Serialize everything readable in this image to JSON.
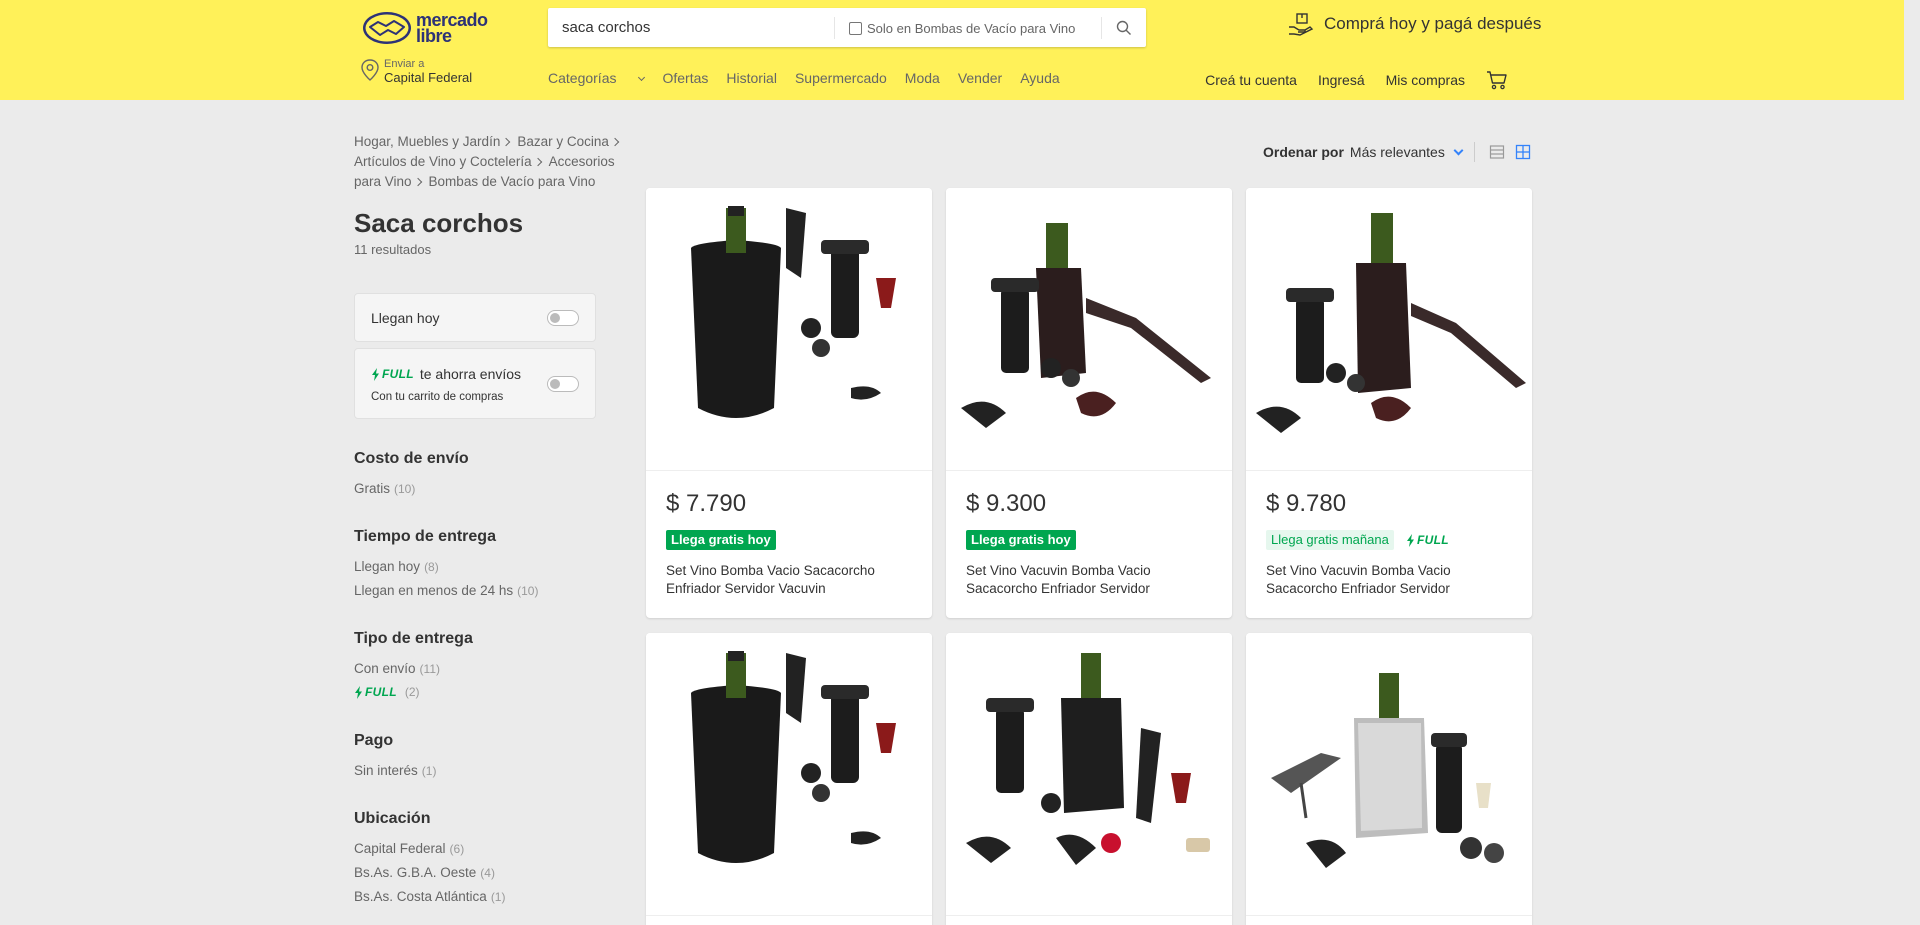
{
  "header": {
    "logo_line1": "mercado",
    "logo_line2": "libre",
    "search_value": "saca corchos",
    "search_scope_label": "Solo en Bombas de Vacío para Vino",
    "promo_text": "Comprá hoy y pagá después",
    "location_small": "Enviar a",
    "location_big": "Capital Federal",
    "nav": [
      "Categorías",
      "Ofertas",
      "Historial",
      "Supermercado",
      "Moda",
      "Vender",
      "Ayuda"
    ],
    "account": [
      "Creá tu cuenta",
      "Ingresá",
      "Mis compras"
    ]
  },
  "breadcrumb": [
    "Hogar, Muebles y Jardín",
    "Bazar y Cocina",
    "Artículos de Vino y Coctelería",
    "Accesorios para Vino",
    "Bombas de Vacío para Vino"
  ],
  "page_title": "Saca corchos",
  "results_count": "11 resultados",
  "filters": {
    "llegan_hoy": "Llegan hoy",
    "full_label": "FULL",
    "full_text": "te ahorra envíos",
    "full_sub": "Con tu carrito de compras"
  },
  "facets": [
    {
      "title": "Costo de envío",
      "items": [
        {
          "label": "Gratis",
          "count": "(10)"
        }
      ]
    },
    {
      "title": "Tiempo de entrega",
      "items": [
        {
          "label": "Llegan hoy",
          "count": "(8)"
        },
        {
          "label": "Llegan en menos de 24 hs",
          "count": "(10)"
        }
      ]
    },
    {
      "title": "Tipo de entrega",
      "items": [
        {
          "label": "Con envío",
          "count": "(11)"
        },
        {
          "label": "FULL",
          "count": "(2)"
        }
      ]
    },
    {
      "title": "Pago",
      "items": [
        {
          "label": "Sin interés",
          "count": "(1)"
        }
      ]
    },
    {
      "title": "Ubicación",
      "items": [
        {
          "label": "Capital Federal",
          "count": "(6)"
        },
        {
          "label": "Bs.As. G.B.A. Oeste",
          "count": "(4)"
        },
        {
          "label": "Bs.As. Costa Atlántica",
          "count": "(1)"
        }
      ]
    }
  ],
  "sort": {
    "label": "Ordenar por",
    "value": "Más relevantes"
  },
  "products": [
    {
      "price": "$ 7.790",
      "badge": "Llega gratis hoy",
      "title": "Set Vino Bomba Vacio Sacacorcho Enfriador Servidor Vacuvin"
    },
    {
      "price": "$ 9.300",
      "badge": "Llega gratis hoy",
      "title": "Set Vino Vacuvin Bomba Vacio Sacacorcho Enfriador Servidor"
    },
    {
      "price": "$ 9.780",
      "badge": "Llega gratis mañana",
      "full": "FULL",
      "title": "Set Vino Vacuvin Bomba Vacio Sacacorcho Enfriador Servidor"
    }
  ],
  "colors": {
    "header_bg": "#fff159",
    "accent_blue": "#3483fa",
    "green": "#00a650",
    "page_bg": "#ebebeb"
  }
}
